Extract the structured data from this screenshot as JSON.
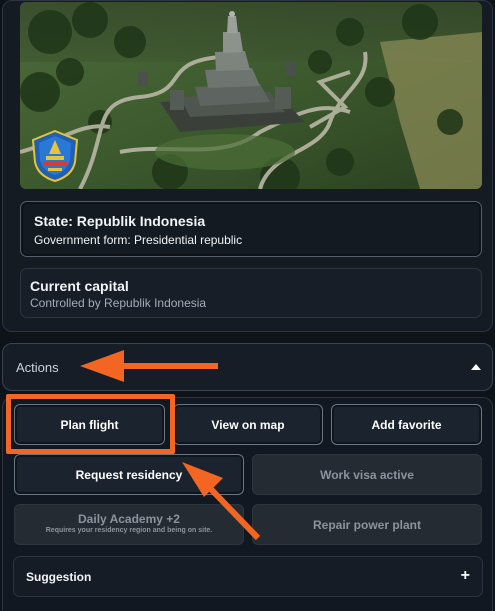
{
  "state_card": {
    "title": "State: Republik Indonesia",
    "government": "Government form: Presidential republic"
  },
  "capital_card": {
    "title": "Current capital",
    "controlled_by": "Controlled by Republik Indonesia"
  },
  "actions": {
    "header_label": "Actions",
    "buttons": {
      "plan_flight": "Plan flight",
      "view_on_map": "View on map",
      "add_favorite": "Add favorite",
      "request_residency": "Request residency",
      "work_visa": "Work visa active",
      "daily_academy": "Daily Academy +2",
      "daily_academy_note": "Requires your residency region and being on site.",
      "repair_power_plant": "Repair power plant"
    }
  },
  "suggestion": {
    "label": "Suggestion",
    "toggle": "+"
  },
  "colors": {
    "annotation_orange": "#f26522",
    "background": "#0e1319",
    "button_border": "#6b7684",
    "disabled_button": "#242b33"
  },
  "icons": {
    "hero_image": "temple-aerial-photo",
    "emblem": "regional-crest-icon",
    "collapse": "caret-up-icon",
    "expand": "plus-icon"
  }
}
